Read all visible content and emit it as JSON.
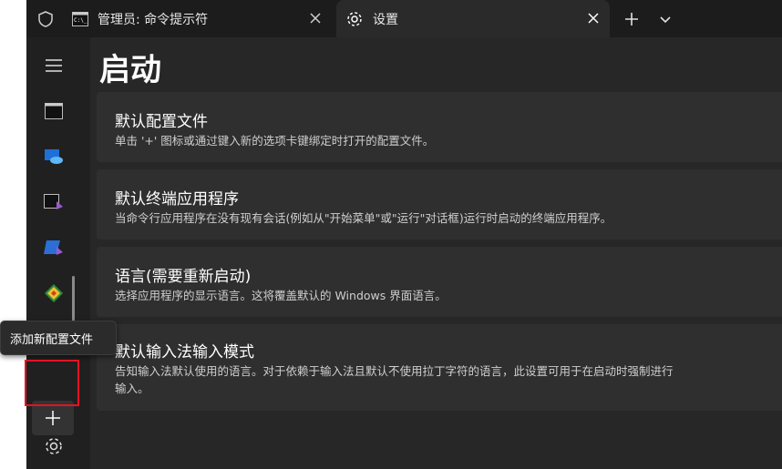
{
  "tabs": [
    {
      "label": "管理员: 命令提示符",
      "active": false
    },
    {
      "label": "设置",
      "active": true
    }
  ],
  "page": {
    "title": "启动"
  },
  "cards": [
    {
      "title": "默认配置文件",
      "desc": "单击 '+' 图标或通过键入新的选项卡键绑定时打开的配置文件。"
    },
    {
      "title": "默认终端应用程序",
      "desc": "当命令行应用程序在没有现有会话(例如从\"开始菜单\"或\"运行\"对话框)运行时启动的终端应用程序。"
    },
    {
      "title": "语言(需要重新启动)",
      "desc": "选择应用程序的显示语言。这将覆盖默认的 Windows 界面语言。"
    },
    {
      "title": "默认输入法输入模式",
      "desc": "告知输入法默认使用的语言。对于依赖于输入法且默认不使用拉丁字符的语言，此设置可用于在启动时强制进行",
      "desc2": "输入。"
    }
  ],
  "tooltip": {
    "text": "添加新配置文件"
  },
  "icons": [
    "shield-icon",
    "cmd-icon",
    "gear-icon",
    "close-icon",
    "plus-icon",
    "chevron-down-icon",
    "hamburger-icon",
    "azure-cloud-icon",
    "developer-cmd-icon",
    "developer-powershell-icon",
    "git-bash-icon"
  ],
  "colors": {
    "background": "#202020",
    "main": "#272727",
    "card": "#2f2f2f",
    "highlight": "#e81123"
  }
}
